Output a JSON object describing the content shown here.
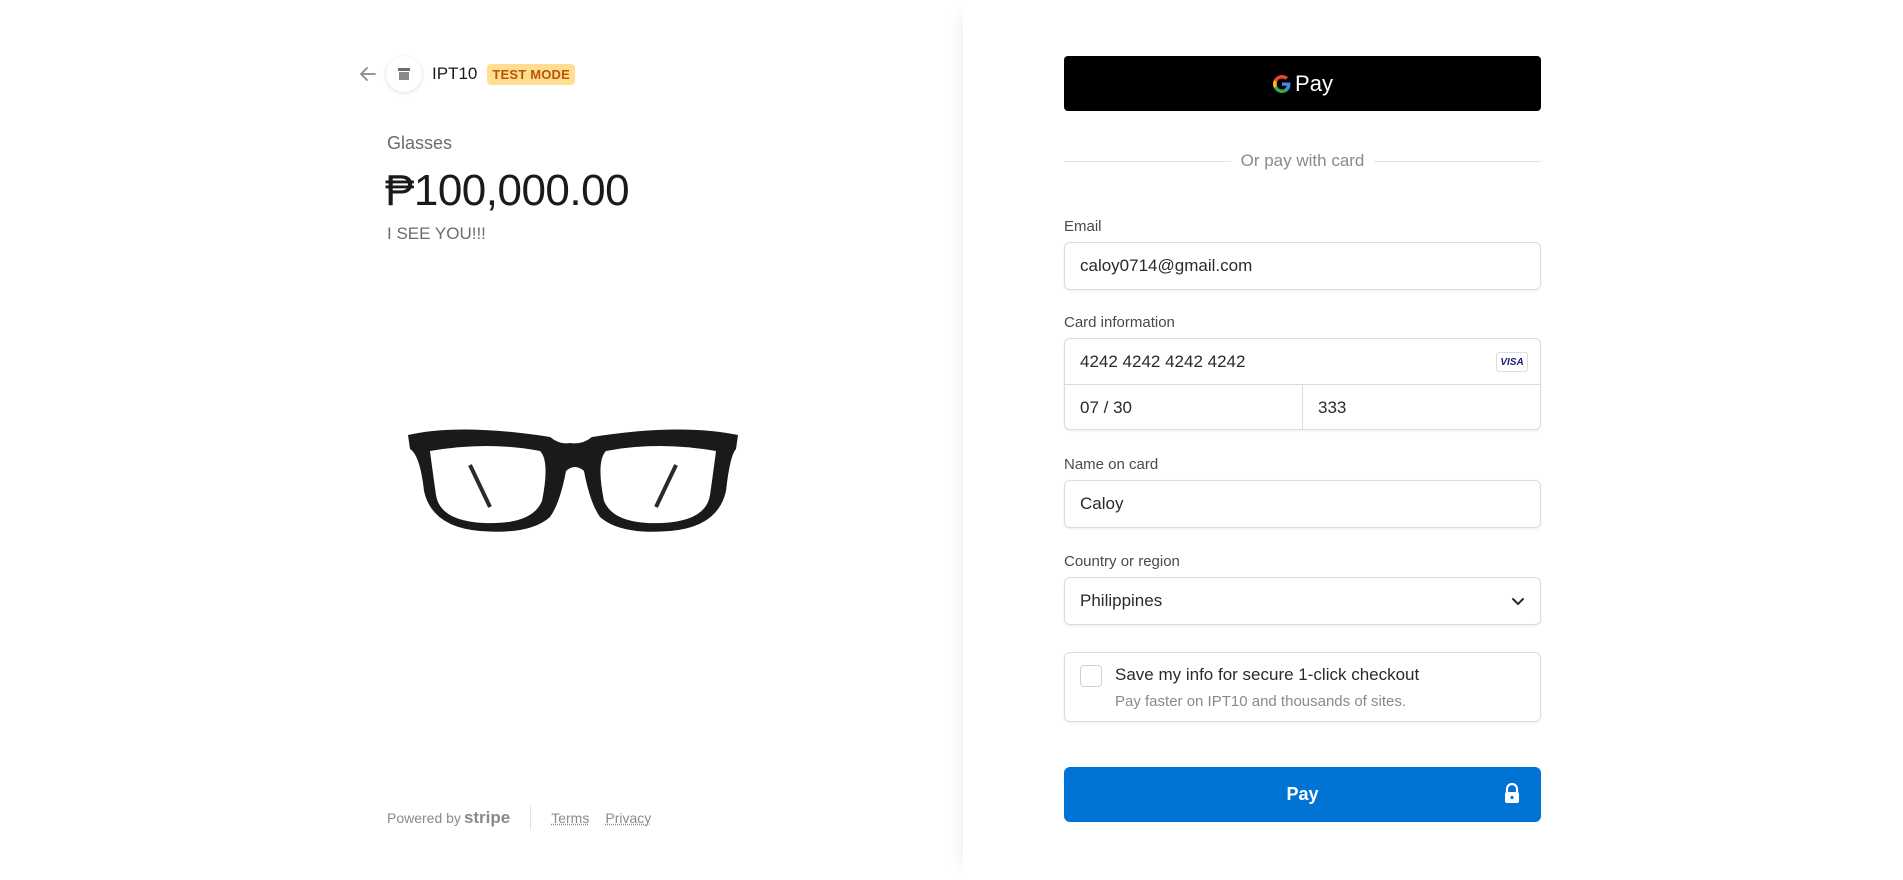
{
  "store": {
    "name": "IPT10",
    "badge": "TEST MODE"
  },
  "product": {
    "name": "Glasses",
    "price": "₱100,000.00",
    "description": "I SEE YOU!!!"
  },
  "footer": {
    "powered_by": "Powered by",
    "brand": "stripe",
    "terms": "Terms",
    "privacy": "Privacy"
  },
  "gpay": {
    "label": "Pay"
  },
  "divider": "Or pay with card",
  "form": {
    "email_label": "Email",
    "email_value": "caloy0714@gmail.com",
    "card_label": "Card information",
    "card_number": "4242 4242 4242 4242",
    "card_brand": "VISA",
    "card_expiry": "07 / 30",
    "card_cvc": "333",
    "name_label": "Name on card",
    "name_value": "Caloy",
    "country_label": "Country or region",
    "country_value": "Philippines",
    "save_title": "Save my info for secure 1-click checkout",
    "save_subtitle": "Pay faster on IPT10 and thousands of sites."
  },
  "pay_button": {
    "label": "Pay"
  },
  "colors": {
    "accent": "#0074d4",
    "badge_bg": "#ffde92",
    "badge_text": "#bb5504"
  }
}
